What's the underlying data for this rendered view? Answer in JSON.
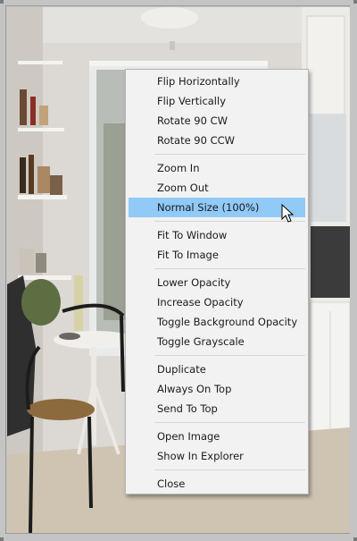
{
  "context_menu": {
    "groups": [
      [
        "Flip Horizontally",
        "Flip Vertically",
        "Rotate 90 CW",
        "Rotate 90 CCW"
      ],
      [
        "Zoom In",
        "Zoom Out",
        "Normal Size (100%)"
      ],
      [
        "Fit To Window",
        "Fit To Image"
      ],
      [
        "Lower Opacity",
        "Increase Opacity",
        "Toggle Background Opacity",
        "Toggle Grayscale"
      ],
      [
        "Duplicate",
        "Always On Top",
        "Send To Top"
      ],
      [
        "Open Image",
        "Show In Explorer"
      ],
      [
        "Close"
      ]
    ],
    "highlighted": "Normal Size (100%)"
  },
  "colors": {
    "menu_background": "#f2f2f2",
    "highlight": "#91c9f7",
    "frame": "#c4c4c4"
  },
  "icons": {
    "cursor": "arrow-pointer-icon"
  }
}
